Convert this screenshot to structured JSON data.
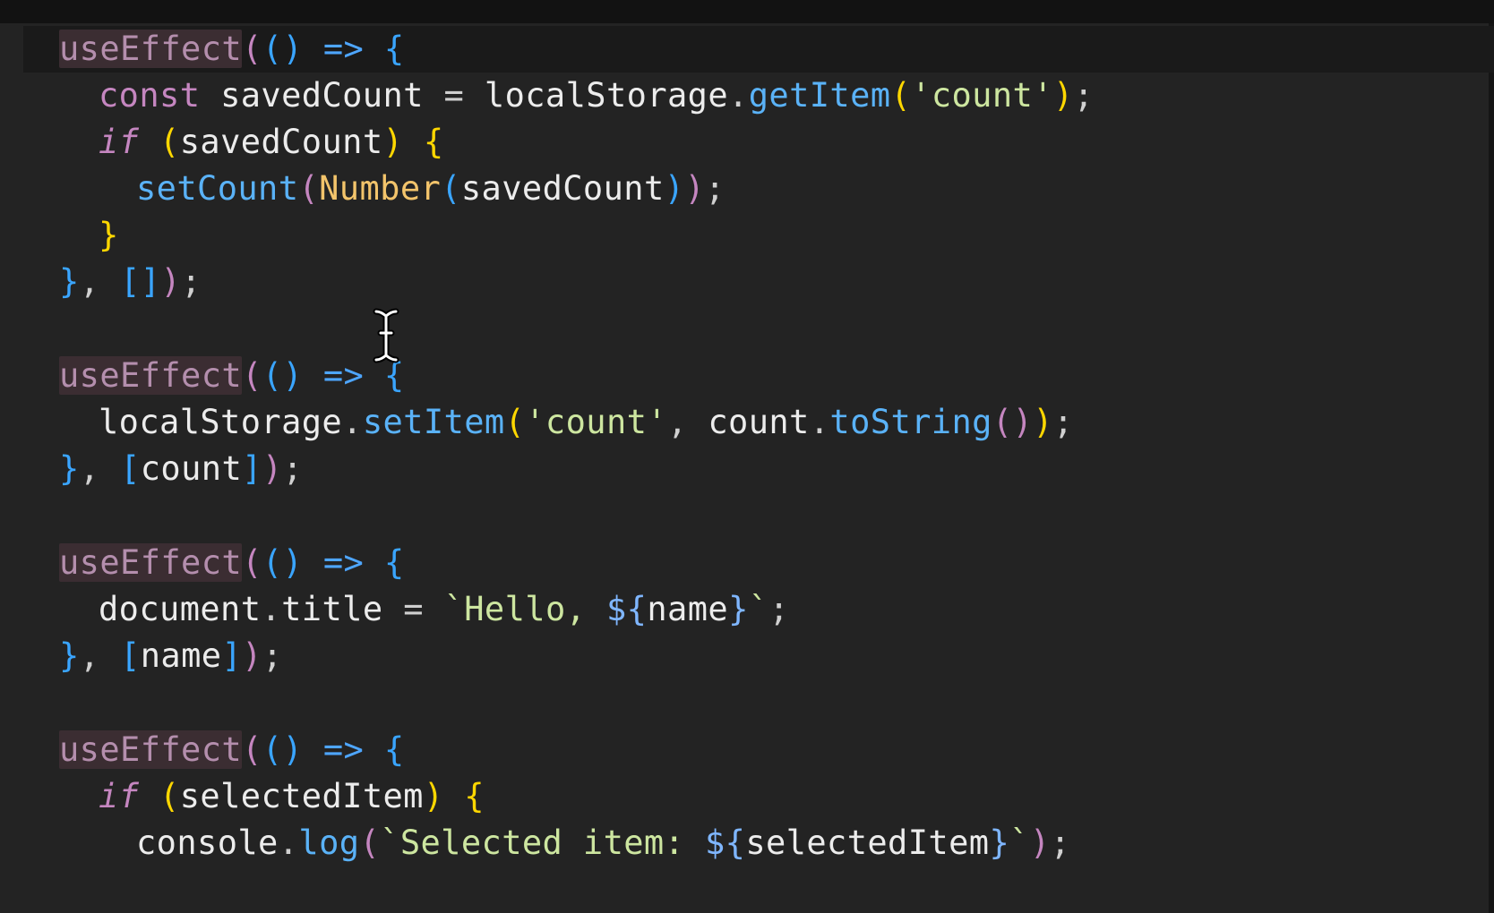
{
  "editor": {
    "language": "javascript",
    "cursor": "text-cursor-icon",
    "colors": {
      "background": "#232323",
      "hook": "#b48ead",
      "function": "#5ab2f7",
      "string": "#cde6a0",
      "keyword": "#c586c0",
      "bracket_blue": "#3aa5ff",
      "bracket_gold": "#ffd700"
    }
  },
  "tokens": {
    "useEffect": "useEffect",
    "arrow_open": "(() => {",
    "const": "const",
    "if": "if",
    "localStorage": "localStorage",
    "getItem": "getItem",
    "setItem": "setItem",
    "setCount": "setCount",
    "Number": "Number",
    "savedCount": "savedCount",
    "count": "count",
    "count_str": "'count'",
    "toString": "toString",
    "document": "document",
    "title": "title",
    "name": "name",
    "selectedItem": "selectedItem",
    "console": "console",
    "log": "log",
    "hello_tmpl_start": "`Hello, ",
    "selected_tmpl_start": "`Selected item: ",
    "tmpl_end": "`",
    "tmpl_open": "${",
    "tmpl_close": "}"
  }
}
